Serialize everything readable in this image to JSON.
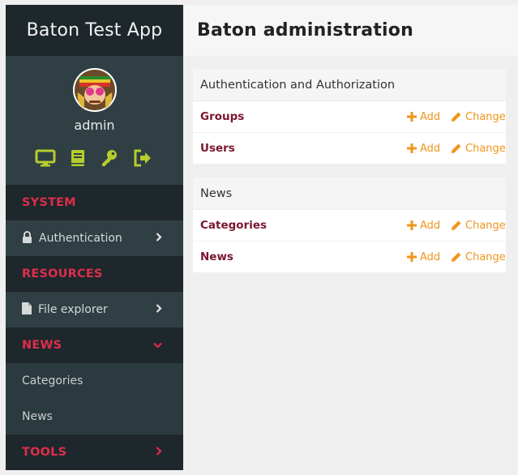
{
  "app": {
    "brand": "Baton Test App",
    "username": "admin"
  },
  "quick_icons": [
    "desktop-icon",
    "book-icon",
    "key-icon",
    "sign-out-icon"
  ],
  "colors": {
    "accent": "#dd2e4d",
    "link": "#7a1630",
    "action": "#f0951c",
    "quick_icon": "#b5cd2d"
  },
  "sidebar": {
    "sections": [
      {
        "title": "SYSTEM"
      },
      {
        "title": "RESOURCES"
      },
      {
        "title": "NEWS"
      },
      {
        "title": "TOOLS"
      }
    ],
    "items": {
      "authentication": "Authentication",
      "file_explorer": "File explorer",
      "categories": "Categories",
      "news": "News"
    }
  },
  "main": {
    "title": "Baton administration",
    "modules": [
      {
        "caption": "Authentication and Authorization",
        "models": [
          {
            "name": "Groups"
          },
          {
            "name": "Users"
          }
        ]
      },
      {
        "caption": "News",
        "models": [
          {
            "name": "Categories"
          },
          {
            "name": "News"
          }
        ]
      }
    ],
    "add_label": "Add",
    "change_label": "Change"
  }
}
